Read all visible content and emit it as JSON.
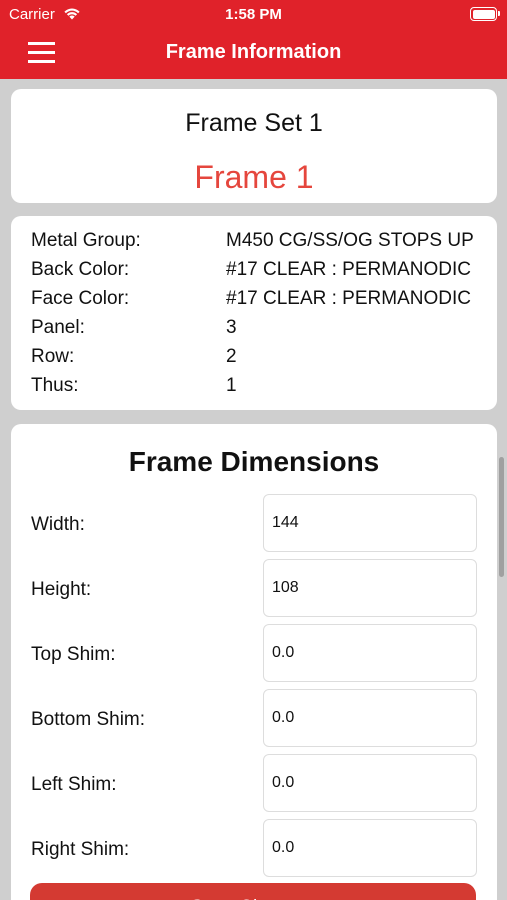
{
  "status_bar": {
    "carrier": "Carrier",
    "time": "1:58 PM",
    "wifi_icon": "wifi-icon",
    "battery_icon": "battery-icon"
  },
  "nav": {
    "title": "Frame Information",
    "menu_icon": "hamburger-menu-icon",
    "color": "#e0222a"
  },
  "frame": {
    "set_title": "Frame Set 1",
    "frame_title": "Frame 1",
    "frame_title_color": "#e5463d"
  },
  "info": {
    "rows": [
      {
        "label": "Metal Group:",
        "value": "M450 CG/SS/OG STOPS UP"
      },
      {
        "label": "Back Color:",
        "value": "#17 CLEAR : PERMANODIC"
      },
      {
        "label": "Face Color:",
        "value": "#17 CLEAR : PERMANODIC"
      },
      {
        "label": "Panel:",
        "value": "3"
      },
      {
        "label": "Row:",
        "value": "2"
      },
      {
        "label": "Thus:",
        "value": "1"
      }
    ]
  },
  "dimensions": {
    "title": "Frame Dimensions",
    "fields": [
      {
        "label": "Width:",
        "value": "144"
      },
      {
        "label": "Height:",
        "value": "108"
      },
      {
        "label": "Top Shim:",
        "value": "0.0"
      },
      {
        "label": "Bottom Shim:",
        "value": "0.0"
      },
      {
        "label": "Left Shim:",
        "value": "0.0"
      },
      {
        "label": "Right Shim:",
        "value": "0.0"
      }
    ]
  },
  "save_button": {
    "label": "Save Changes",
    "color": "#d43a32"
  }
}
